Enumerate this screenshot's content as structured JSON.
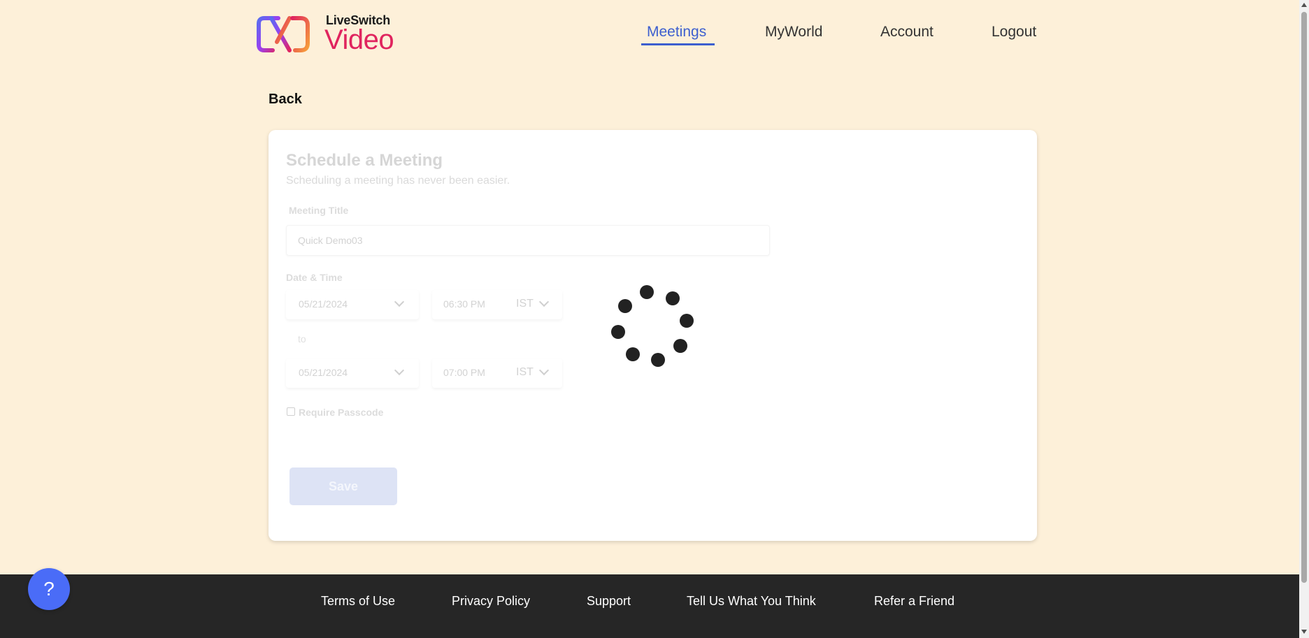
{
  "brand": {
    "name_small": "LiveSwitch",
    "name_big": "Video",
    "colors": {
      "primary_pink": "#e0245e",
      "primary_purple": "#7b3ff2",
      "primary_orange": "#f2762e"
    }
  },
  "nav": {
    "items": [
      {
        "label": "Meetings",
        "active": true
      },
      {
        "label": "MyWorld",
        "active": false
      },
      {
        "label": "Account",
        "active": false
      },
      {
        "label": "Logout",
        "active": false
      }
    ]
  },
  "back_label": "Back",
  "form": {
    "title": "Schedule a Meeting",
    "subtitle": "Scheduling a meeting has never been easier.",
    "meeting_title_label": "Meeting Title",
    "meeting_title_value": "Quick Demo03",
    "datetime_label": "Date & Time",
    "start": {
      "date": "05/21/2024",
      "time": "06:30 PM",
      "timezone": "IST"
    },
    "to_label": "to",
    "end": {
      "date": "05/21/2024",
      "time": "07:00 PM",
      "timezone": "IST"
    },
    "passcode_label": "Require Passcode",
    "passcode_checked": false,
    "save_label": "Save"
  },
  "loading": {
    "state": "loading",
    "icon": "spinner-icon"
  },
  "help": {
    "icon": "?"
  },
  "footer": {
    "links": [
      "Terms of Use",
      "Privacy Policy",
      "Support",
      "Tell Us What You Think",
      "Refer a Friend"
    ]
  }
}
